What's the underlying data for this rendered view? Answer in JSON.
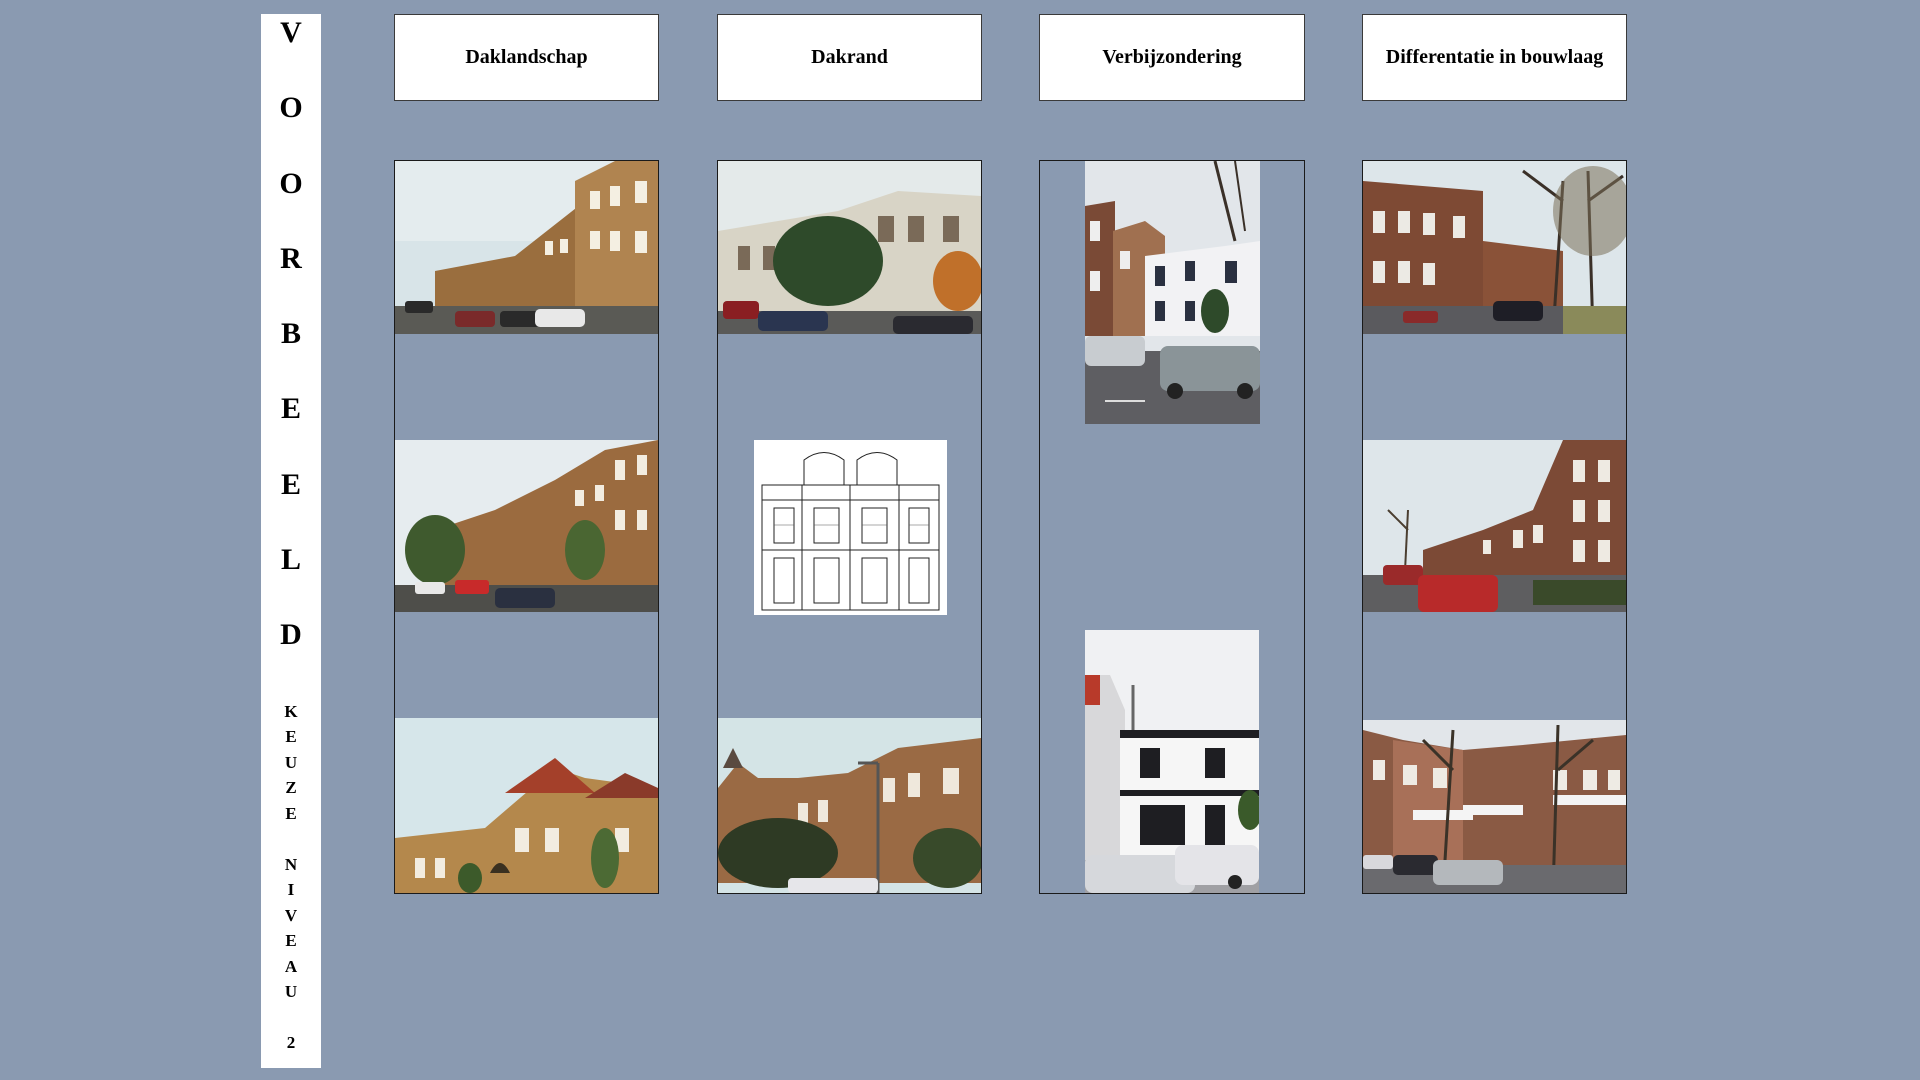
{
  "banner": {
    "big_letters": [
      "V",
      "O",
      "O",
      "R",
      "B",
      "E",
      "E",
      "L",
      "D"
    ],
    "small_word_1": [
      "K",
      "E",
      "U",
      "Z",
      "E"
    ],
    "small_word_2": [
      "N",
      "I",
      "V",
      "E",
      "A",
      "U"
    ],
    "small_number": "2"
  },
  "columns": [
    {
      "label": "Daklandschap"
    },
    {
      "label": "Dakrand"
    },
    {
      "label": "Verbijzondering"
    },
    {
      "label": "Differentatie in bouwlaag"
    }
  ],
  "photos": {
    "col1": [
      "street-of-brick-houses-photo",
      "street-with-trees-photo",
      "corner-villa-photo"
    ],
    "col2": [
      "terraced-houses-photo",
      "facade-drawing",
      "street-with-lamp-photo"
    ],
    "col3": [
      "corner-white-house-photo",
      "white-house-facade-photo"
    ],
    "col4": [
      "brick-street-with-trees-photo",
      "row-houses-photo",
      "apartment-balconies-photo"
    ]
  }
}
